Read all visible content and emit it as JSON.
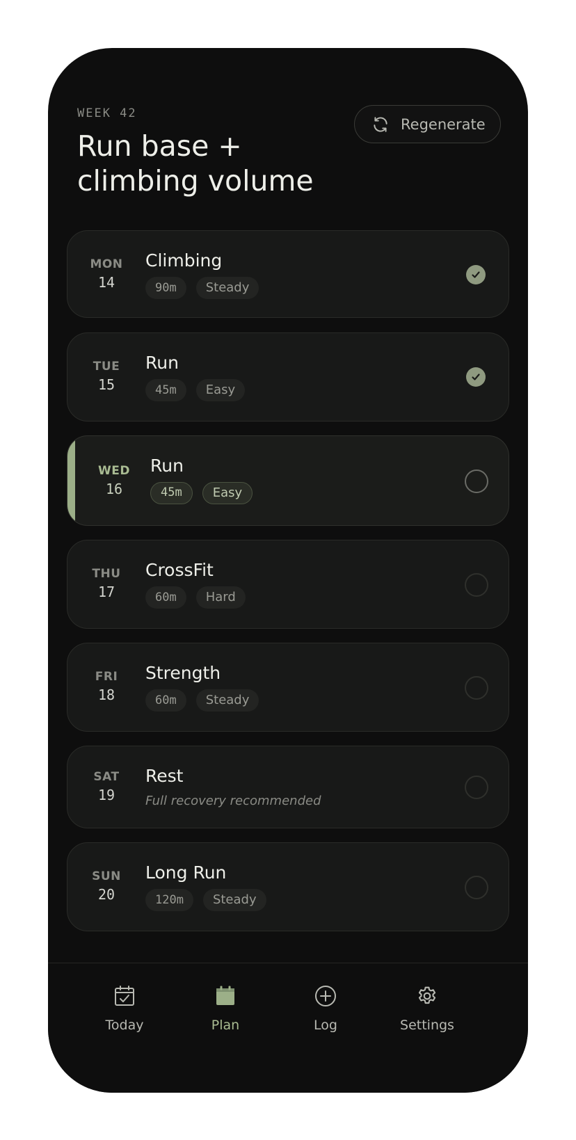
{
  "header": {
    "week_label": "WEEK 42",
    "title": "Run base + climbing volume",
    "regenerate_label": "Regenerate"
  },
  "days": [
    {
      "day": "MON",
      "date": "14",
      "activity": "Climbing",
      "duration": "90m",
      "intensity": "Steady",
      "status": "done"
    },
    {
      "day": "TUE",
      "date": "15",
      "activity": "Run",
      "duration": "45m",
      "intensity": "Easy",
      "status": "done"
    },
    {
      "day": "WED",
      "date": "16",
      "activity": "Run",
      "duration": "45m",
      "intensity": "Easy",
      "status": "todo"
    },
    {
      "day": "THU",
      "date": "17",
      "activity": "CrossFit",
      "duration": "60m",
      "intensity": "Hard",
      "status": "todo"
    },
    {
      "day": "FRI",
      "date": "18",
      "activity": "Strength",
      "duration": "60m",
      "intensity": "Steady",
      "status": "todo"
    },
    {
      "day": "SAT",
      "date": "19",
      "activity": "Rest",
      "note": "Full recovery recommended",
      "status": "todo"
    },
    {
      "day": "SUN",
      "date": "20",
      "activity": "Long Run",
      "duration": "120m",
      "intensity": "Steady",
      "status": "todo"
    }
  ],
  "today_index": 2,
  "tabbar": {
    "items": [
      {
        "label": "Today",
        "icon": "calendar-check-icon"
      },
      {
        "label": "Plan",
        "icon": "calendar-filled-icon"
      },
      {
        "label": "Log",
        "icon": "plus-circle-icon"
      },
      {
        "label": "Settings",
        "icon": "gear-icon"
      }
    ],
    "active": "Plan"
  },
  "colors": {
    "background": "#0e0e0e",
    "card": "#181918",
    "accent": "#9caf88",
    "text": "#eeefe9",
    "muted": "#8a8b85"
  }
}
